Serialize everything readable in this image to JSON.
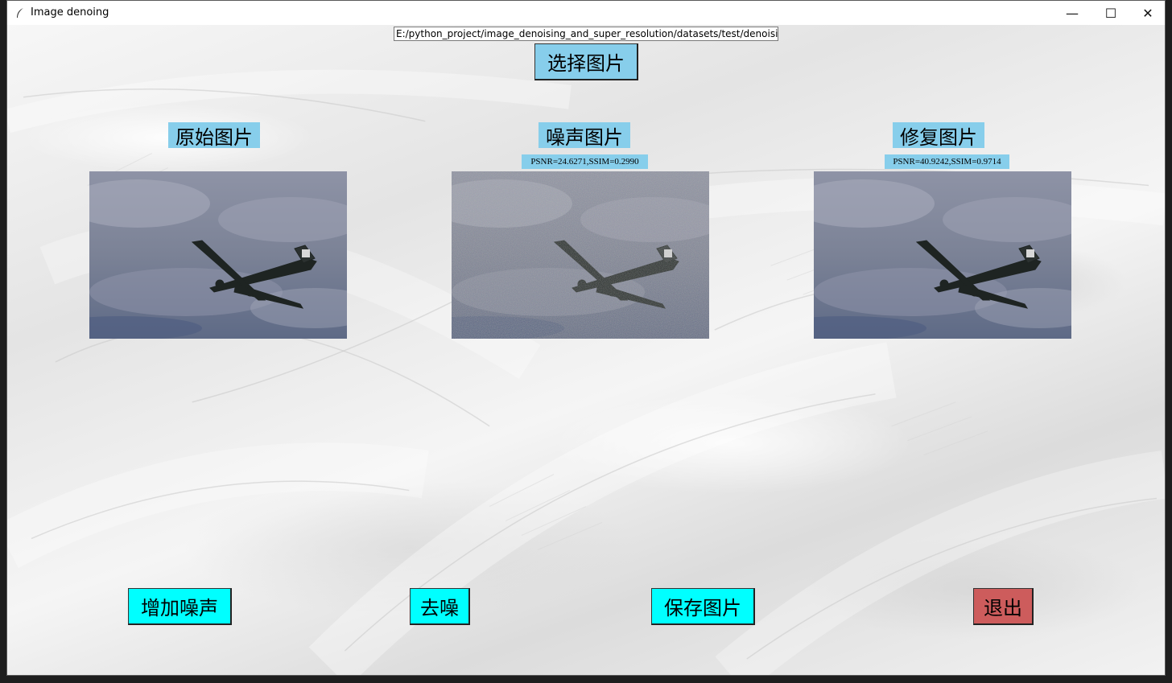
{
  "window": {
    "title": "Image denoing"
  },
  "controls": {
    "minimize": "—",
    "maximize": "☐",
    "close": "✕"
  },
  "path_field": {
    "value": "E:/python_project/image_denoising_and_super_resolution/datasets/test/denoising/"
  },
  "buttons": {
    "select_image": "选择图片",
    "add_noise": "增加噪声",
    "denoise": "去噪",
    "save_image": "保存图片",
    "exit": "退出"
  },
  "panels": [
    {
      "label": "原始图片",
      "metric": ""
    },
    {
      "label": "噪声图片",
      "metric": "PSNR=24.6271,SSIM=0.2990"
    },
    {
      "label": "修复图片",
      "metric": "PSNR=40.9242,SSIM=0.9714"
    }
  ],
  "colors": {
    "label_bg": "#87ceeb",
    "action_button": "#00ffff",
    "exit_button": "#cd5c5c",
    "sky": "#7d8498"
  },
  "icons": {
    "app": "feather-icon",
    "minimize": "minimize-icon",
    "maximize": "maximize-icon",
    "close": "close-icon"
  }
}
